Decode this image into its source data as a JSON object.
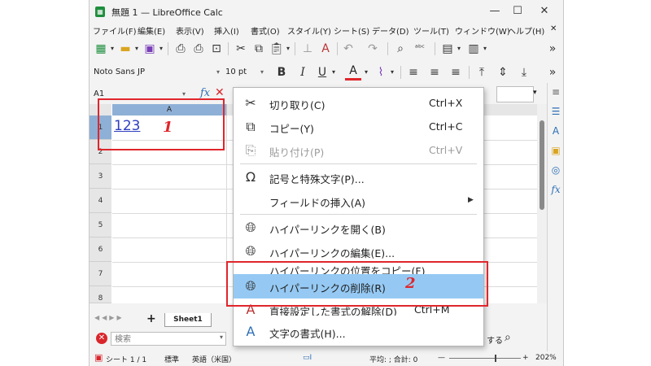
{
  "window": {
    "title": "無題 1 — LibreOffice Calc",
    "app_icon": "calc-icon",
    "controls": [
      "—",
      "☐",
      "✕"
    ]
  },
  "menubar": {
    "items": [
      "ファイル(F)",
      "編集(E)",
      "表示(V)",
      "挿入(I)",
      "書式(O)",
      "スタイル(Y)",
      "シート(S)",
      "データ(D)",
      "ツール(T)",
      "ウィンドウ(W)",
      "ヘルプ(H)"
    ],
    "close": "✕"
  },
  "format_toolbar": {
    "font_name": "Noto Sans JP",
    "font_size": "10 pt",
    "bold": "B",
    "italic": "I",
    "underline": "U",
    "font_color_accent": "#e0262c"
  },
  "formula_bar": {
    "name_box": "A1",
    "fx": "fx"
  },
  "sheet": {
    "column_header": "A",
    "rows": [
      "1",
      "2",
      "3",
      "4",
      "5",
      "6",
      "7",
      "8"
    ],
    "cell_a1": "123",
    "tab": "Sheet1",
    "add_sheet": "+"
  },
  "find_bar": {
    "placeholder": "検索",
    "trailing": "する"
  },
  "status_bar": {
    "sheet": "シート 1 / 1",
    "style": "標準",
    "language": "英語（米国）",
    "sum": "平均: ; 合計: 0",
    "zoom": "202%"
  },
  "context_menu": {
    "items": [
      {
        "icon": "scissors-icon",
        "label": "切り取り(C)",
        "shortcut": "Ctrl+X",
        "enabled": true
      },
      {
        "icon": "copy-icon",
        "label": "コピー(Y)",
        "shortcut": "Ctrl+C",
        "enabled": true
      },
      {
        "icon": "paste-icon",
        "label": "貼り付け(P)",
        "shortcut": "Ctrl+V",
        "enabled": false
      },
      {
        "icon": "omega-icon",
        "label": "記号と特殊文字(P)...",
        "shortcut": "",
        "enabled": true
      },
      {
        "icon": "",
        "label": "フィールドの挿入(A)",
        "shortcut": "",
        "enabled": true,
        "submenu": true
      },
      {
        "icon": "globe-open-icon",
        "label": "ハイパーリンクを開く(B)",
        "shortcut": "",
        "enabled": true
      },
      {
        "icon": "globe-edit-icon",
        "label": "ハイパーリンクの編集(E)...",
        "shortcut": "",
        "enabled": true
      },
      {
        "icon": "",
        "label": "ハイパーリンクの位置をコピー(F)",
        "shortcut": "",
        "enabled": true
      },
      {
        "icon": "globe-remove-icon",
        "label": "ハイパーリンクの削除(R)",
        "shortcut": "",
        "enabled": true,
        "highlighted": true
      },
      {
        "icon": "clear-format-icon",
        "label": "直接設定した書式の解除(D)",
        "shortcut": "Ctrl+M",
        "enabled": true
      },
      {
        "icon": "character-icon",
        "label": "文字の書式(H)...",
        "shortcut": "",
        "enabled": true
      }
    ]
  },
  "annotations": {
    "step1": "1",
    "step2": "2",
    "color": "#e0262c"
  }
}
